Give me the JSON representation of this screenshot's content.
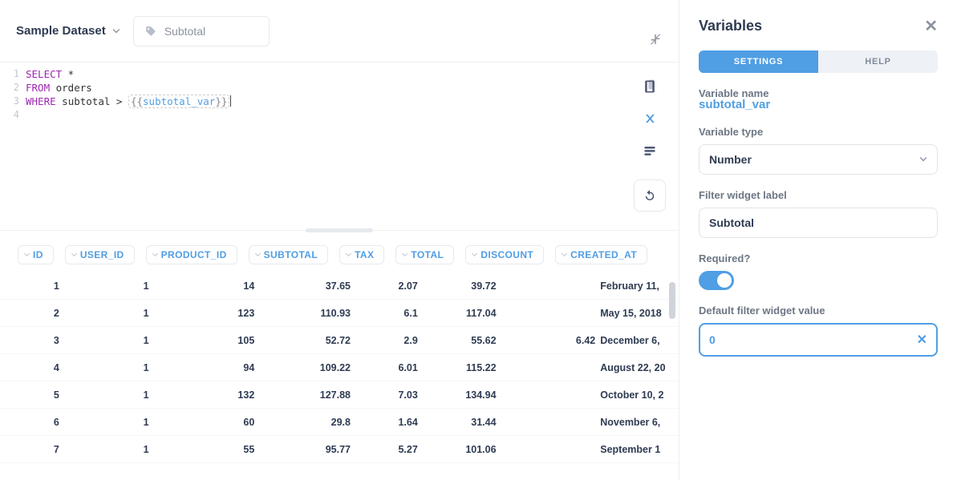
{
  "datasource": {
    "label": "Sample Dataset"
  },
  "filter_chip": {
    "label": "Subtotal"
  },
  "editor": {
    "line_numbers": [
      "1",
      "2",
      "3",
      "4"
    ],
    "kw_select": "SELECT",
    "star": " *",
    "kw_from": "FROM",
    "from_ident": " orders",
    "kw_where": "WHERE",
    "where_lhs": " subtotal > ",
    "tmpl_open": "{{",
    "tmpl_name": "subtotal_var",
    "tmpl_close": "}}"
  },
  "columns": [
    {
      "label": "ID",
      "cls": "c0"
    },
    {
      "label": "USER_ID",
      "cls": "c1"
    },
    {
      "label": "PRODUCT_ID",
      "cls": "c2"
    },
    {
      "label": "SUBTOTAL",
      "cls": "c3"
    },
    {
      "label": "TAX",
      "cls": "c4"
    },
    {
      "label": "TOTAL",
      "cls": "c5"
    },
    {
      "label": "DISCOUNT",
      "cls": "c6"
    },
    {
      "label": "CREATED_AT",
      "cls": "c7"
    }
  ],
  "rows": [
    {
      "id": "1",
      "user_id": "1",
      "product_id": "14",
      "subtotal": "37.65",
      "tax": "2.07",
      "total": "39.72",
      "discount": "",
      "created_at": "February 11,"
    },
    {
      "id": "2",
      "user_id": "1",
      "product_id": "123",
      "subtotal": "110.93",
      "tax": "6.1",
      "total": "117.04",
      "discount": "",
      "created_at": "May 15, 2018"
    },
    {
      "id": "3",
      "user_id": "1",
      "product_id": "105",
      "subtotal": "52.72",
      "tax": "2.9",
      "total": "55.62",
      "discount": "6.42",
      "created_at": "December 6,"
    },
    {
      "id": "4",
      "user_id": "1",
      "product_id": "94",
      "subtotal": "109.22",
      "tax": "6.01",
      "total": "115.22",
      "discount": "",
      "created_at": "August 22, 20"
    },
    {
      "id": "5",
      "user_id": "1",
      "product_id": "132",
      "subtotal": "127.88",
      "tax": "7.03",
      "total": "134.94",
      "discount": "",
      "created_at": "October 10, 2"
    },
    {
      "id": "6",
      "user_id": "1",
      "product_id": "60",
      "subtotal": "29.8",
      "tax": "1.64",
      "total": "31.44",
      "discount": "",
      "created_at": "November 6,"
    },
    {
      "id": "7",
      "user_id": "1",
      "product_id": "55",
      "subtotal": "95.77",
      "tax": "5.27",
      "total": "101.06",
      "discount": "",
      "created_at": "September 1"
    }
  ],
  "panel": {
    "title": "Variables",
    "tabs": {
      "settings": "SETTINGS",
      "help": "HELP"
    },
    "var_name_label": "Variable name",
    "var_name_value": "subtotal_var",
    "var_type_label": "Variable type",
    "var_type_value": "Number",
    "widget_label_label": "Filter widget label",
    "widget_label_value": "Subtotal",
    "required_label": "Required?",
    "default_label": "Default filter widget value",
    "default_value": "0"
  }
}
